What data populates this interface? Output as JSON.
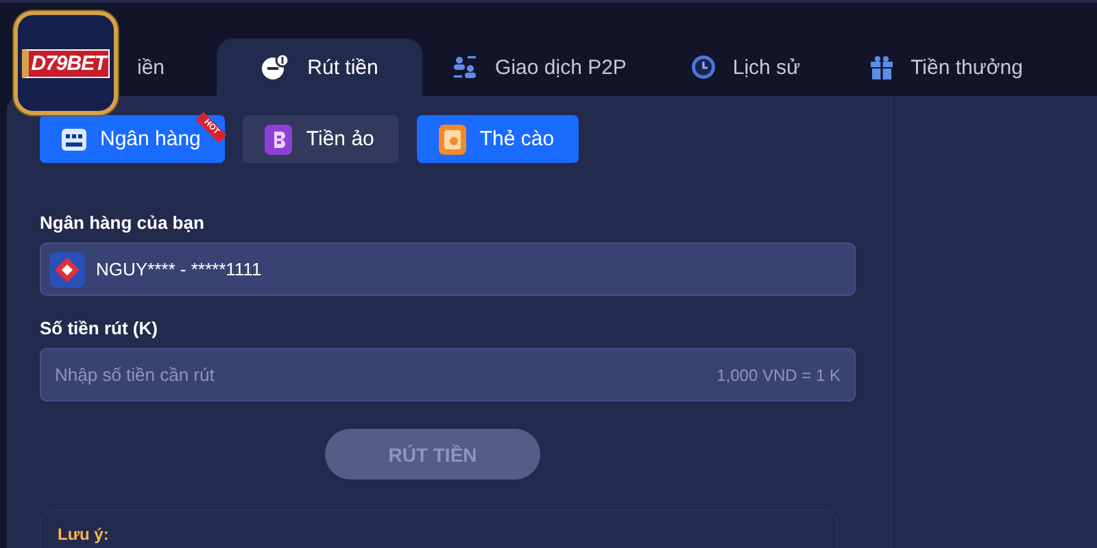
{
  "logo": {
    "text": "D79BET"
  },
  "tabs": [
    {
      "label": "iền",
      "selected": false
    },
    {
      "label": "Rút tiền",
      "selected": true
    },
    {
      "label": "Giao dịch P2P",
      "selected": false
    },
    {
      "label": "Lịch sử",
      "selected": false
    },
    {
      "label": "Tiền thưởng",
      "selected": false
    }
  ],
  "methods": [
    {
      "label": "Ngân hàng",
      "badge": "HOT",
      "selected": true
    },
    {
      "label": "Tiền ảo",
      "selected": false
    },
    {
      "label": "Thẻ cào",
      "selected": true
    }
  ],
  "bank_field": {
    "label": "Ngân hàng của bạn",
    "value": "NGUY**** - *****1111"
  },
  "amount_field": {
    "label": "Số tiền rút (K)",
    "placeholder": "Nhập số tiền cần rút",
    "hint": "1,000 VND = 1 K"
  },
  "submit": {
    "label": "RÚT TIỀN",
    "disabled": true
  },
  "note": {
    "title": "Lưu ý:"
  }
}
